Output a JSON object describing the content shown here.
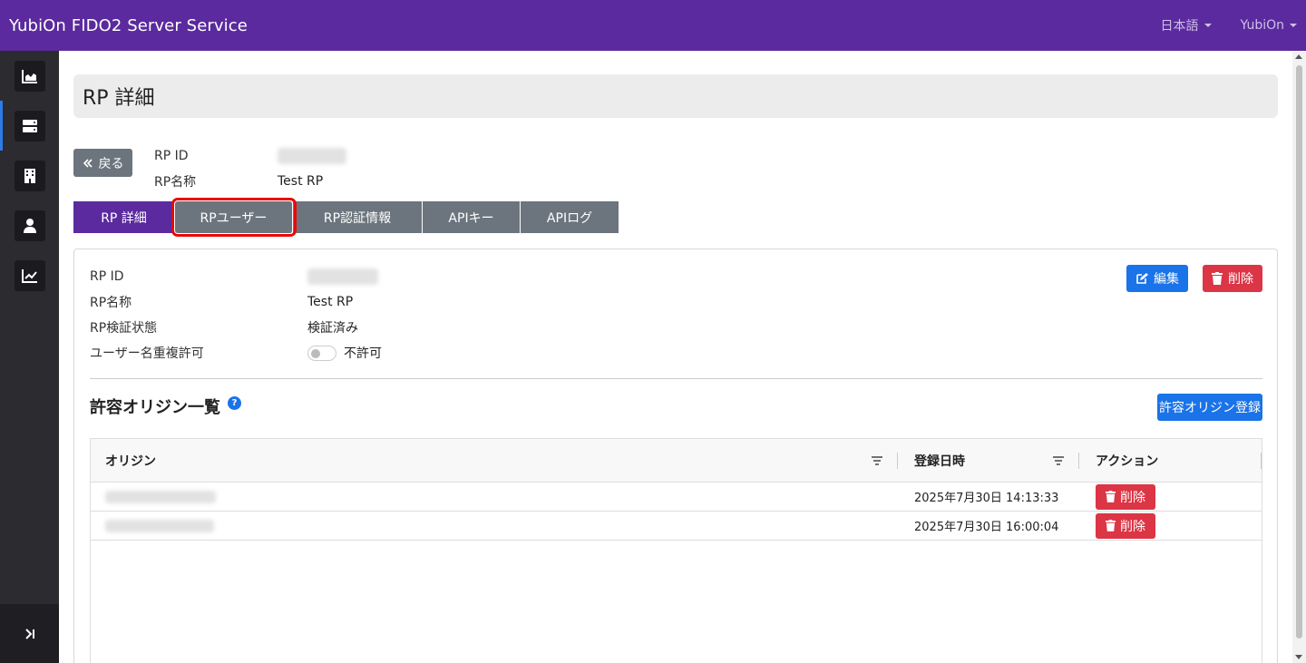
{
  "header": {
    "brand": "YubiOn FIDO2 Server Service",
    "language": "日本語",
    "user": "YubiOn"
  },
  "sidebar": {
    "items": [
      {
        "icon": "dashboard-chart-icon"
      },
      {
        "icon": "server-icon",
        "active": true
      },
      {
        "icon": "building-icon"
      },
      {
        "icon": "user-icon"
      },
      {
        "icon": "line-chart-icon"
      }
    ],
    "collapse_icon": "collapse-sidebar-icon"
  },
  "page": {
    "title": "RP 詳細"
  },
  "top_info": {
    "back_label": "戻る",
    "rp_id_label": "RP ID",
    "rp_name_label": "RP名称",
    "rp_name_value": "Test RP"
  },
  "tabs": [
    {
      "label": "RP 詳細",
      "active": true
    },
    {
      "label": "RPユーザー",
      "highlighted": true
    },
    {
      "label": "RP認証情報"
    },
    {
      "label": "APIキー"
    },
    {
      "label": "APIログ"
    }
  ],
  "detail": {
    "rp_id_label": "RP ID",
    "rp_name_label": "RP名称",
    "rp_name_value": "Test RP",
    "verify_label": "RP検証状態",
    "verify_value": "検証済み",
    "dup_label": "ユーザー名重複許可",
    "dup_value": "不許可",
    "dup_enabled": false,
    "edit_label": "編集",
    "delete_label": "削除"
  },
  "origins": {
    "title": "許容オリジン一覧",
    "help_icon": "question-circle-icon",
    "add_label": "許容オリジン登録",
    "columns": {
      "origin": "オリジン",
      "date": "登録日時",
      "action": "アクション"
    },
    "rows": [
      {
        "date": "2025年7月30日 14:13:33",
        "delete_label": "削除"
      },
      {
        "date": "2025年7月30日 16:00:04",
        "delete_label": "削除"
      }
    ]
  }
}
